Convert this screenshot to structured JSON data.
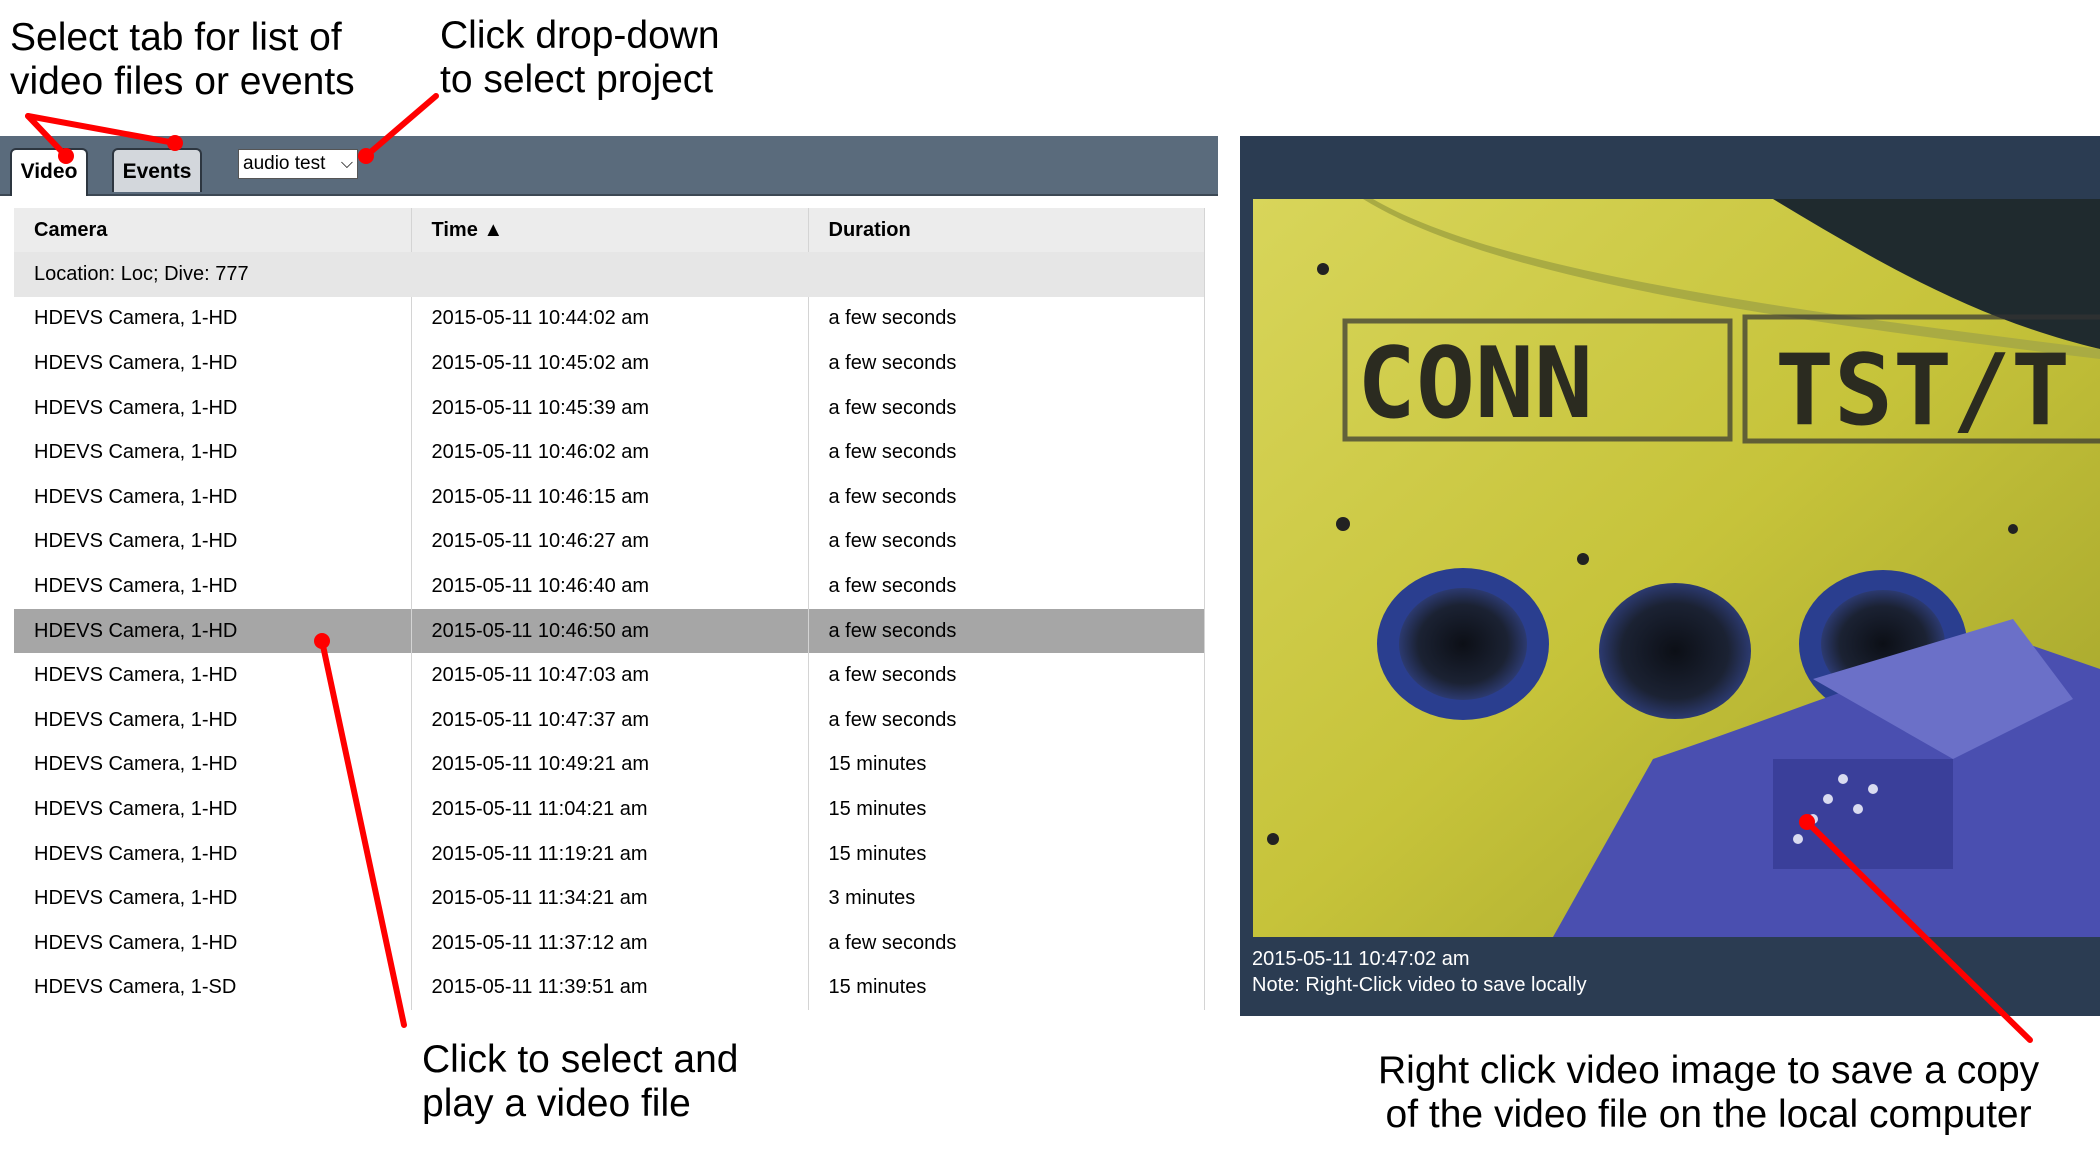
{
  "annotations": {
    "tabs": [
      "Select tab for list of",
      "video files or events"
    ],
    "dropdown": [
      "Click drop-down",
      "to select project"
    ],
    "select": [
      "Click to select and",
      "play a video file"
    ],
    "save": [
      "Right click video image to save a copy",
      "of the video file on the local computer"
    ]
  },
  "tabs": {
    "video": "Video",
    "events": "Events"
  },
  "project_select": {
    "value": "audio test"
  },
  "table": {
    "headers": {
      "camera": "Camera",
      "time": "Time ▲",
      "duration": "Duration"
    },
    "group": "Location: Loc; Dive: 777",
    "rows": [
      {
        "camera": "HDEVS Camera, 1-HD",
        "time": "2015-05-11 10:44:02 am",
        "duration": "a few seconds"
      },
      {
        "camera": "HDEVS Camera, 1-HD",
        "time": "2015-05-11 10:45:02 am",
        "duration": "a few seconds"
      },
      {
        "camera": "HDEVS Camera, 1-HD",
        "time": "2015-05-11 10:45:39 am",
        "duration": "a few seconds"
      },
      {
        "camera": "HDEVS Camera, 1-HD",
        "time": "2015-05-11 10:46:02 am",
        "duration": "a few seconds"
      },
      {
        "camera": "HDEVS Camera, 1-HD",
        "time": "2015-05-11 10:46:15 am",
        "duration": "a few seconds"
      },
      {
        "camera": "HDEVS Camera, 1-HD",
        "time": "2015-05-11 10:46:27 am",
        "duration": "a few seconds"
      },
      {
        "camera": "HDEVS Camera, 1-HD",
        "time": "2015-05-11 10:46:40 am",
        "duration": "a few seconds"
      },
      {
        "camera": "HDEVS Camera, 1-HD",
        "time": "2015-05-11 10:46:50 am",
        "duration": "a few seconds",
        "selected": true
      },
      {
        "camera": "HDEVS Camera, 1-HD",
        "time": "2015-05-11 10:47:03 am",
        "duration": "a few seconds"
      },
      {
        "camera": "HDEVS Camera, 1-HD",
        "time": "2015-05-11 10:47:37 am",
        "duration": "a few seconds"
      },
      {
        "camera": "HDEVS Camera, 1-HD",
        "time": "2015-05-11 10:49:21 am",
        "duration": "15 minutes"
      },
      {
        "camera": "HDEVS Camera, 1-HD",
        "time": "2015-05-11 11:04:21 am",
        "duration": "15 minutes"
      },
      {
        "camera": "HDEVS Camera, 1-HD",
        "time": "2015-05-11 11:19:21 am",
        "duration": "15 minutes"
      },
      {
        "camera": "HDEVS Camera, 1-HD",
        "time": "2015-05-11 11:34:21 am",
        "duration": "3 minutes"
      },
      {
        "camera": "HDEVS Camera, 1-HD",
        "time": "2015-05-11 11:37:12 am",
        "duration": "a few seconds"
      },
      {
        "camera": "HDEVS Camera, 1-SD",
        "time": "2015-05-11 11:39:51 am",
        "duration": "15 minutes"
      }
    ]
  },
  "video": {
    "markings": [
      "CONN",
      "TST/T"
    ],
    "timestamp": "2015-05-11 10:47:02 am",
    "note": "Note: Right-Click video to save locally"
  },
  "colors": {
    "arrow": "#ff0000",
    "tabbar": "#5a6b7c",
    "video_panel": "#2b3c52",
    "selected_row": "#a6a6a6"
  }
}
